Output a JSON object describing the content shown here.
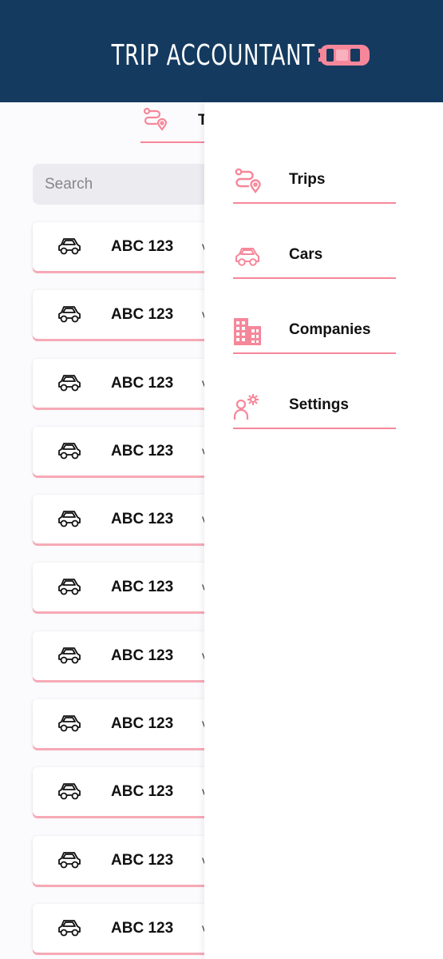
{
  "header": {
    "title": "TRIP ACCOUNTANT",
    "logo_icon": "car-top-view-icon",
    "background": "#143a5f",
    "accent": "#f6879a"
  },
  "tab": {
    "icon": "route-icon",
    "label": "T"
  },
  "search": {
    "placeholder": "Search"
  },
  "cars": [
    {
      "plate": "ABC 123",
      "arrow": "v"
    },
    {
      "plate": "ABC 123",
      "arrow": "v"
    },
    {
      "plate": "ABC 123",
      "arrow": "v"
    },
    {
      "plate": "ABC 123",
      "arrow": "v"
    },
    {
      "plate": "ABC 123",
      "arrow": "v"
    },
    {
      "plate": "ABC 123",
      "arrow": "v"
    },
    {
      "plate": "ABC 123",
      "arrow": "v"
    },
    {
      "plate": "ABC 123",
      "arrow": "v"
    },
    {
      "plate": "ABC 123",
      "arrow": "v"
    },
    {
      "plate": "ABC 123",
      "arrow": "v"
    },
    {
      "plate": "ABC 123",
      "arrow": "v"
    }
  ],
  "drawer": {
    "items": [
      {
        "label": "Trips",
        "icon": "route-icon"
      },
      {
        "label": "Cars",
        "icon": "car-icon"
      },
      {
        "label": "Companies",
        "icon": "building-icon"
      },
      {
        "label": "Settings",
        "icon": "user-settings-icon"
      }
    ]
  }
}
